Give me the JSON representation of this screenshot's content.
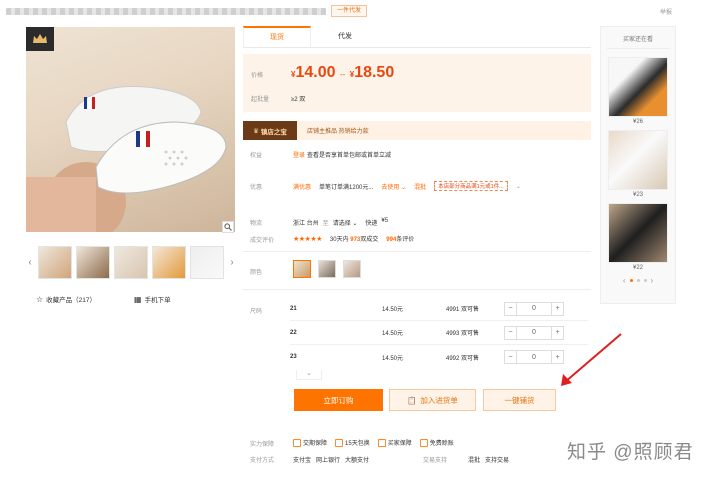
{
  "topbar": {
    "tag": "一件代发",
    "right": "举报"
  },
  "gallery": {
    "favorite_label": "收藏产品（217）",
    "mobile_order_label": "手机下单"
  },
  "tabs": [
    {
      "label": "现货"
    },
    {
      "label": "代发"
    }
  ],
  "price": {
    "price_label": "价格",
    "currency": "¥",
    "low": "14.00",
    "sep": "--",
    "high": "18.50",
    "moq_label": "起批量",
    "moq": "≥2 双"
  },
  "shop_banner": {
    "badge": "镇店之宝",
    "text": "店铺主推品  热销给力款"
  },
  "rights": {
    "label": "权益",
    "tag": "登录",
    "text": "查看是否享首单包邮或首单立减"
  },
  "promo": {
    "label": "优惠",
    "tag": "满优惠",
    "text": "单笔订单满1200元...",
    "more": "去使用",
    "tag2": "混批",
    "notice": "本店部分商品满1元或1件..."
  },
  "shipping": {
    "label": "物流",
    "from": "浙江 台州",
    "to_prefix": "至",
    "to": "请选择",
    "method": "快递",
    "fee": "¥5"
  },
  "rating": {
    "label": "成交评价",
    "stars": "★★★★★",
    "deals_prefix": "30天内",
    "deals": "973",
    "deals_suffix": "双成交",
    "reviews": "994",
    "reviews_suffix": "条评价"
  },
  "colors": {
    "label": "颜色",
    "count": 3
  },
  "sizes": {
    "label": "尺码",
    "rows": [
      {
        "size": "21",
        "price": "14.50元",
        "stock": "4991 双可售",
        "qty": "0"
      },
      {
        "size": "22",
        "price": "14.50元",
        "stock": "4993 双可售",
        "qty": "0"
      },
      {
        "size": "23",
        "price": "14.50元",
        "stock": "4992 双可售",
        "qty": "0"
      }
    ],
    "minus": "−",
    "plus": "+"
  },
  "actions": {
    "order": "立即订购",
    "cart": "加入进货单",
    "dropship": "一键铺货"
  },
  "services": {
    "label": "实力保障",
    "items": [
      "交期保障",
      "15天包换",
      "买家保障",
      "免费赊账"
    ]
  },
  "payment": {
    "label": "支付方式",
    "items": [
      "支付宝",
      "网上银行",
      "大额支付"
    ],
    "trade_label": "交易支持",
    "trade_items": [
      "混批",
      "支持交易"
    ]
  },
  "recommend": {
    "title": "买家还在看",
    "items": [
      {
        "price": "¥26"
      },
      {
        "price": "¥23"
      },
      {
        "price": "¥22"
      }
    ]
  },
  "watermark": "知乎 @照顾君",
  "colors_theme": {
    "accent": "#ff7300",
    "price": "#e8480f",
    "panel": "#fdf3e9"
  }
}
